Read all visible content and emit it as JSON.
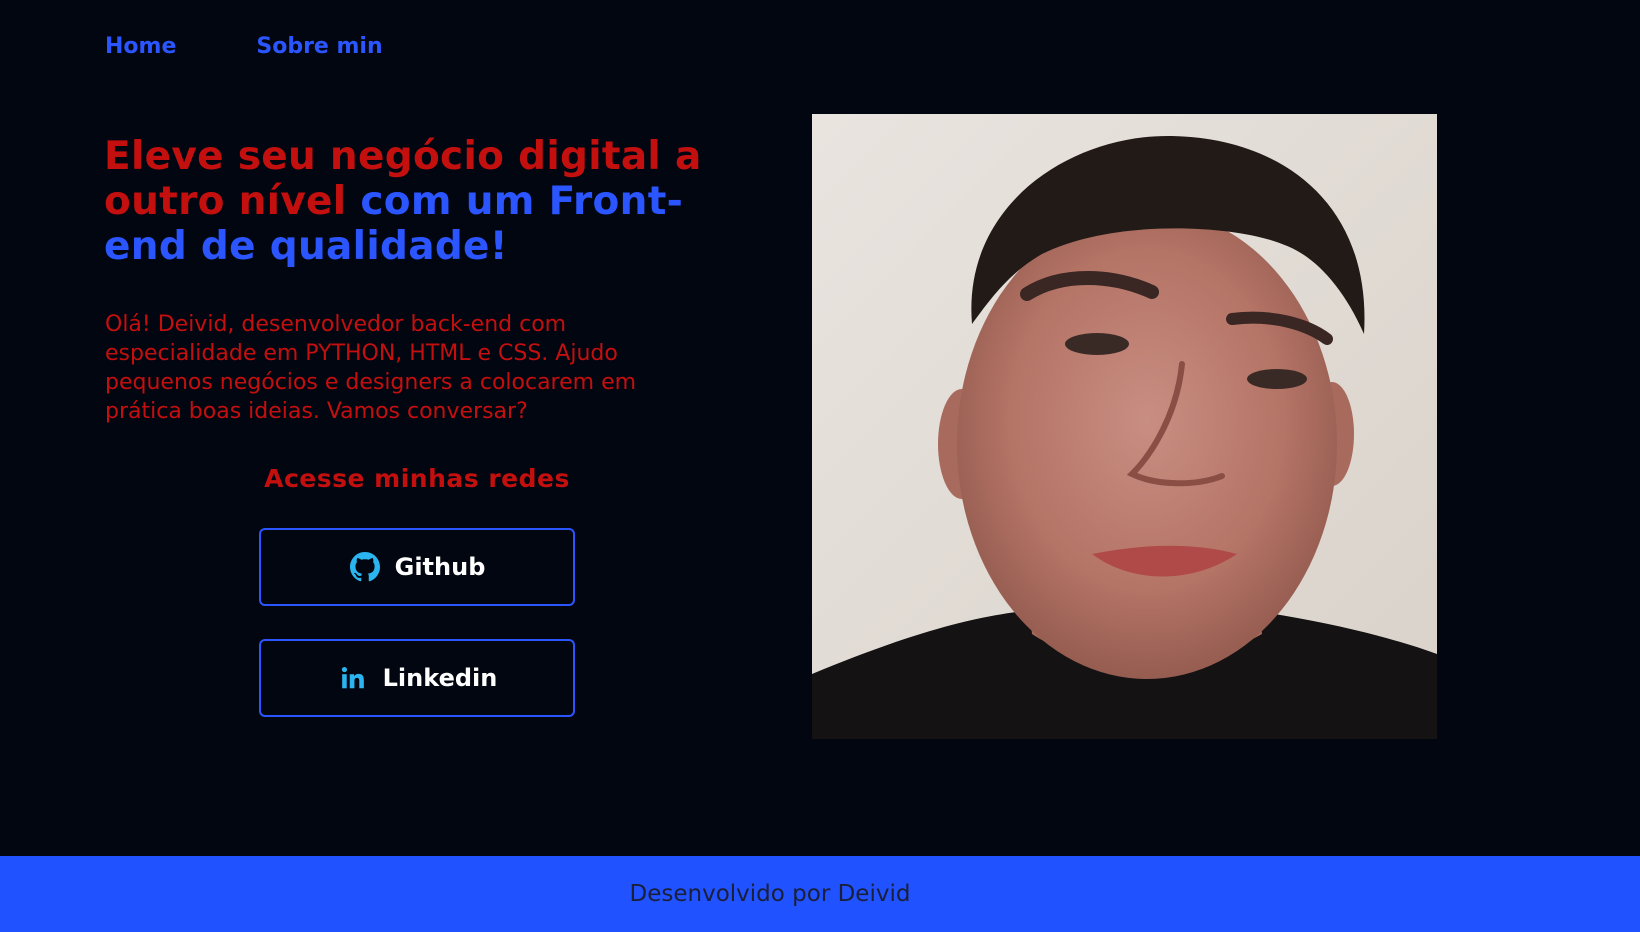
{
  "nav": {
    "items": [
      "Home",
      "Sobre min"
    ]
  },
  "hero": {
    "title_part1": "Eleve seu negócio digital a outro nível",
    "title_part2": "com um Front-end de qualidade!",
    "intro": "Olá! Deivid, desenvolvedor back-end com especialidade em PYTHON, HTML e CSS. Ajudo pequenos negócios e designers a colocarem em prática boas ideias. Vamos conversar?"
  },
  "networks": {
    "title": "Acesse minhas redes",
    "buttons": [
      {
        "label": "Github",
        "icon": "github-icon"
      },
      {
        "label": "Linkedin",
        "icon": "linkedin-icon"
      }
    ]
  },
  "photo": {
    "alt": "Deivid"
  },
  "footer": {
    "text": "Desenvolvido por Deivid"
  },
  "colors": {
    "background": "#020611",
    "accent_red": "#c40f0f",
    "accent_blue": "#2a55ff",
    "footer": "#2152ff",
    "icon_cyan": "#2bb5f0"
  }
}
